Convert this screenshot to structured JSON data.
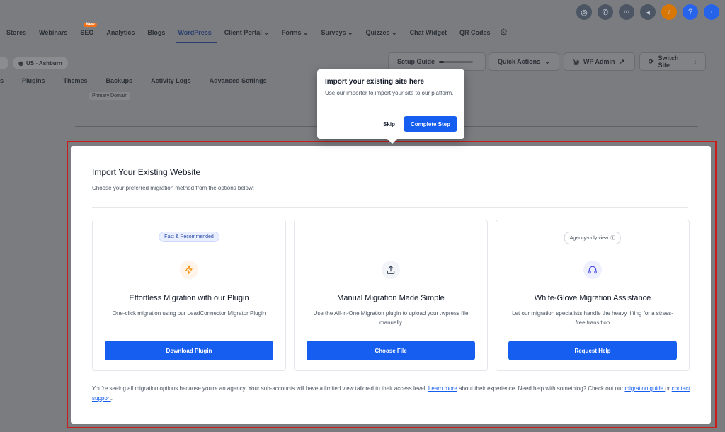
{
  "colors": {
    "accent": "#155eef",
    "highlight": "#c81e1e",
    "orange_icon": "#f79009",
    "indigo_icon": "#444ce7"
  },
  "nav": {
    "items": [
      "Stores",
      "Webinars",
      "SEO",
      "Analytics",
      "Blogs",
      "WordPress",
      "Client Portal",
      "Forms",
      "Surveys",
      "Quizzes",
      "Chat Widget",
      "QR Codes"
    ],
    "seo_badge": "New"
  },
  "site_selector": "US - Ashburn",
  "toolbar": {
    "setup_guide": "Setup Guide",
    "setup_progress": 0.15,
    "quick_actions": "Quick Actions",
    "wp_admin": "WP Admin",
    "switch_site": "Switch Site"
  },
  "subnav": [
    "s",
    "Plugins",
    "Themes",
    "Backups",
    "Activity Logs",
    "Advanced Settings"
  ],
  "primary_domain": "Primary Domain",
  "popover": {
    "title": "Import your existing site here",
    "text": "Use our importer to import your site to our platform.",
    "skip": "Skip",
    "complete": "Complete Step"
  },
  "card": {
    "title": "Import Your Existing Website",
    "subtitle": "Choose your preferred migration method from the options below:",
    "options": [
      {
        "badge": "Fast & Recommended",
        "icon": "lightning-bolt-icon",
        "heading": "Effortless Migration with our Plugin",
        "desc": "One-click migration using our LeadConnector Migrator Plugin",
        "button": "Download Plugin"
      },
      {
        "badge": "",
        "icon": "upload-icon",
        "heading": "Manual Migration Made Simple",
        "desc": "Use the All-in-One Migration plugin to upload your .wpress file manually",
        "button": "Choose File"
      },
      {
        "badge": "Agency-only view",
        "icon": "headset-icon",
        "heading": "White-Glove Migration Assistance",
        "desc": "Let our migration specialists handle the heavy lifting for a stress-free transition",
        "button": "Request Help"
      }
    ],
    "footnote": {
      "part1": "You're seeing all migration options because you're an agency. Your sub-accounts will have a limited view tailored to their access level. ",
      "learn_more": "Learn more",
      "part2": " about their experience. Need help with something? Check out our ",
      "migration_guide": "migration guide ",
      "part3": "or ",
      "contact_support": "contact support",
      "part4": "."
    }
  }
}
